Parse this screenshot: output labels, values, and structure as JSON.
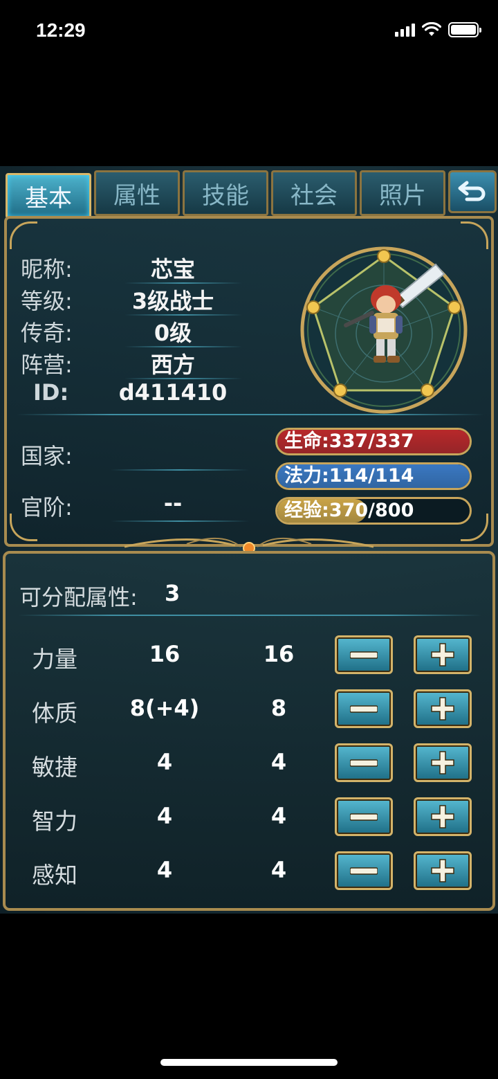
{
  "status_bar": {
    "time": "12:29"
  },
  "tabs": [
    {
      "label": "基本",
      "active": true
    },
    {
      "label": "属性",
      "active": false
    },
    {
      "label": "技能",
      "active": false
    },
    {
      "label": "社会",
      "active": false
    },
    {
      "label": "照片",
      "active": false
    }
  ],
  "profile": {
    "nickname_label": "昵称:",
    "nickname": "芯宝",
    "level_label": "等级:",
    "level": "3级战士",
    "legend_label": "传奇:",
    "legend": "0级",
    "faction_label": "阵营:",
    "faction": "西方",
    "id_label": "ID:",
    "id": "d411410",
    "country_label": "国家:",
    "country": "",
    "rank_label": "官阶:",
    "rank": "--"
  },
  "bars": {
    "hp": {
      "text": "生命:337/337",
      "fraction": 1.0,
      "color": "#b8282a"
    },
    "mp": {
      "text": "法力:114/114",
      "fraction": 1.0,
      "color": "#3a78c2"
    },
    "exp": {
      "text": "经验:370/800",
      "fraction": 0.4625,
      "color": "#c9a347"
    }
  },
  "allocation": {
    "label": "可分配属性:",
    "value": "3"
  },
  "stats": [
    {
      "name": "力量",
      "current": "16",
      "base": "16"
    },
    {
      "name": "体质",
      "current": "8(+4)",
      "base": "8"
    },
    {
      "name": "敏捷",
      "current": "4",
      "base": "4"
    },
    {
      "name": "智力",
      "current": "4",
      "base": "4"
    },
    {
      "name": "感知",
      "current": "4",
      "base": "4"
    }
  ]
}
